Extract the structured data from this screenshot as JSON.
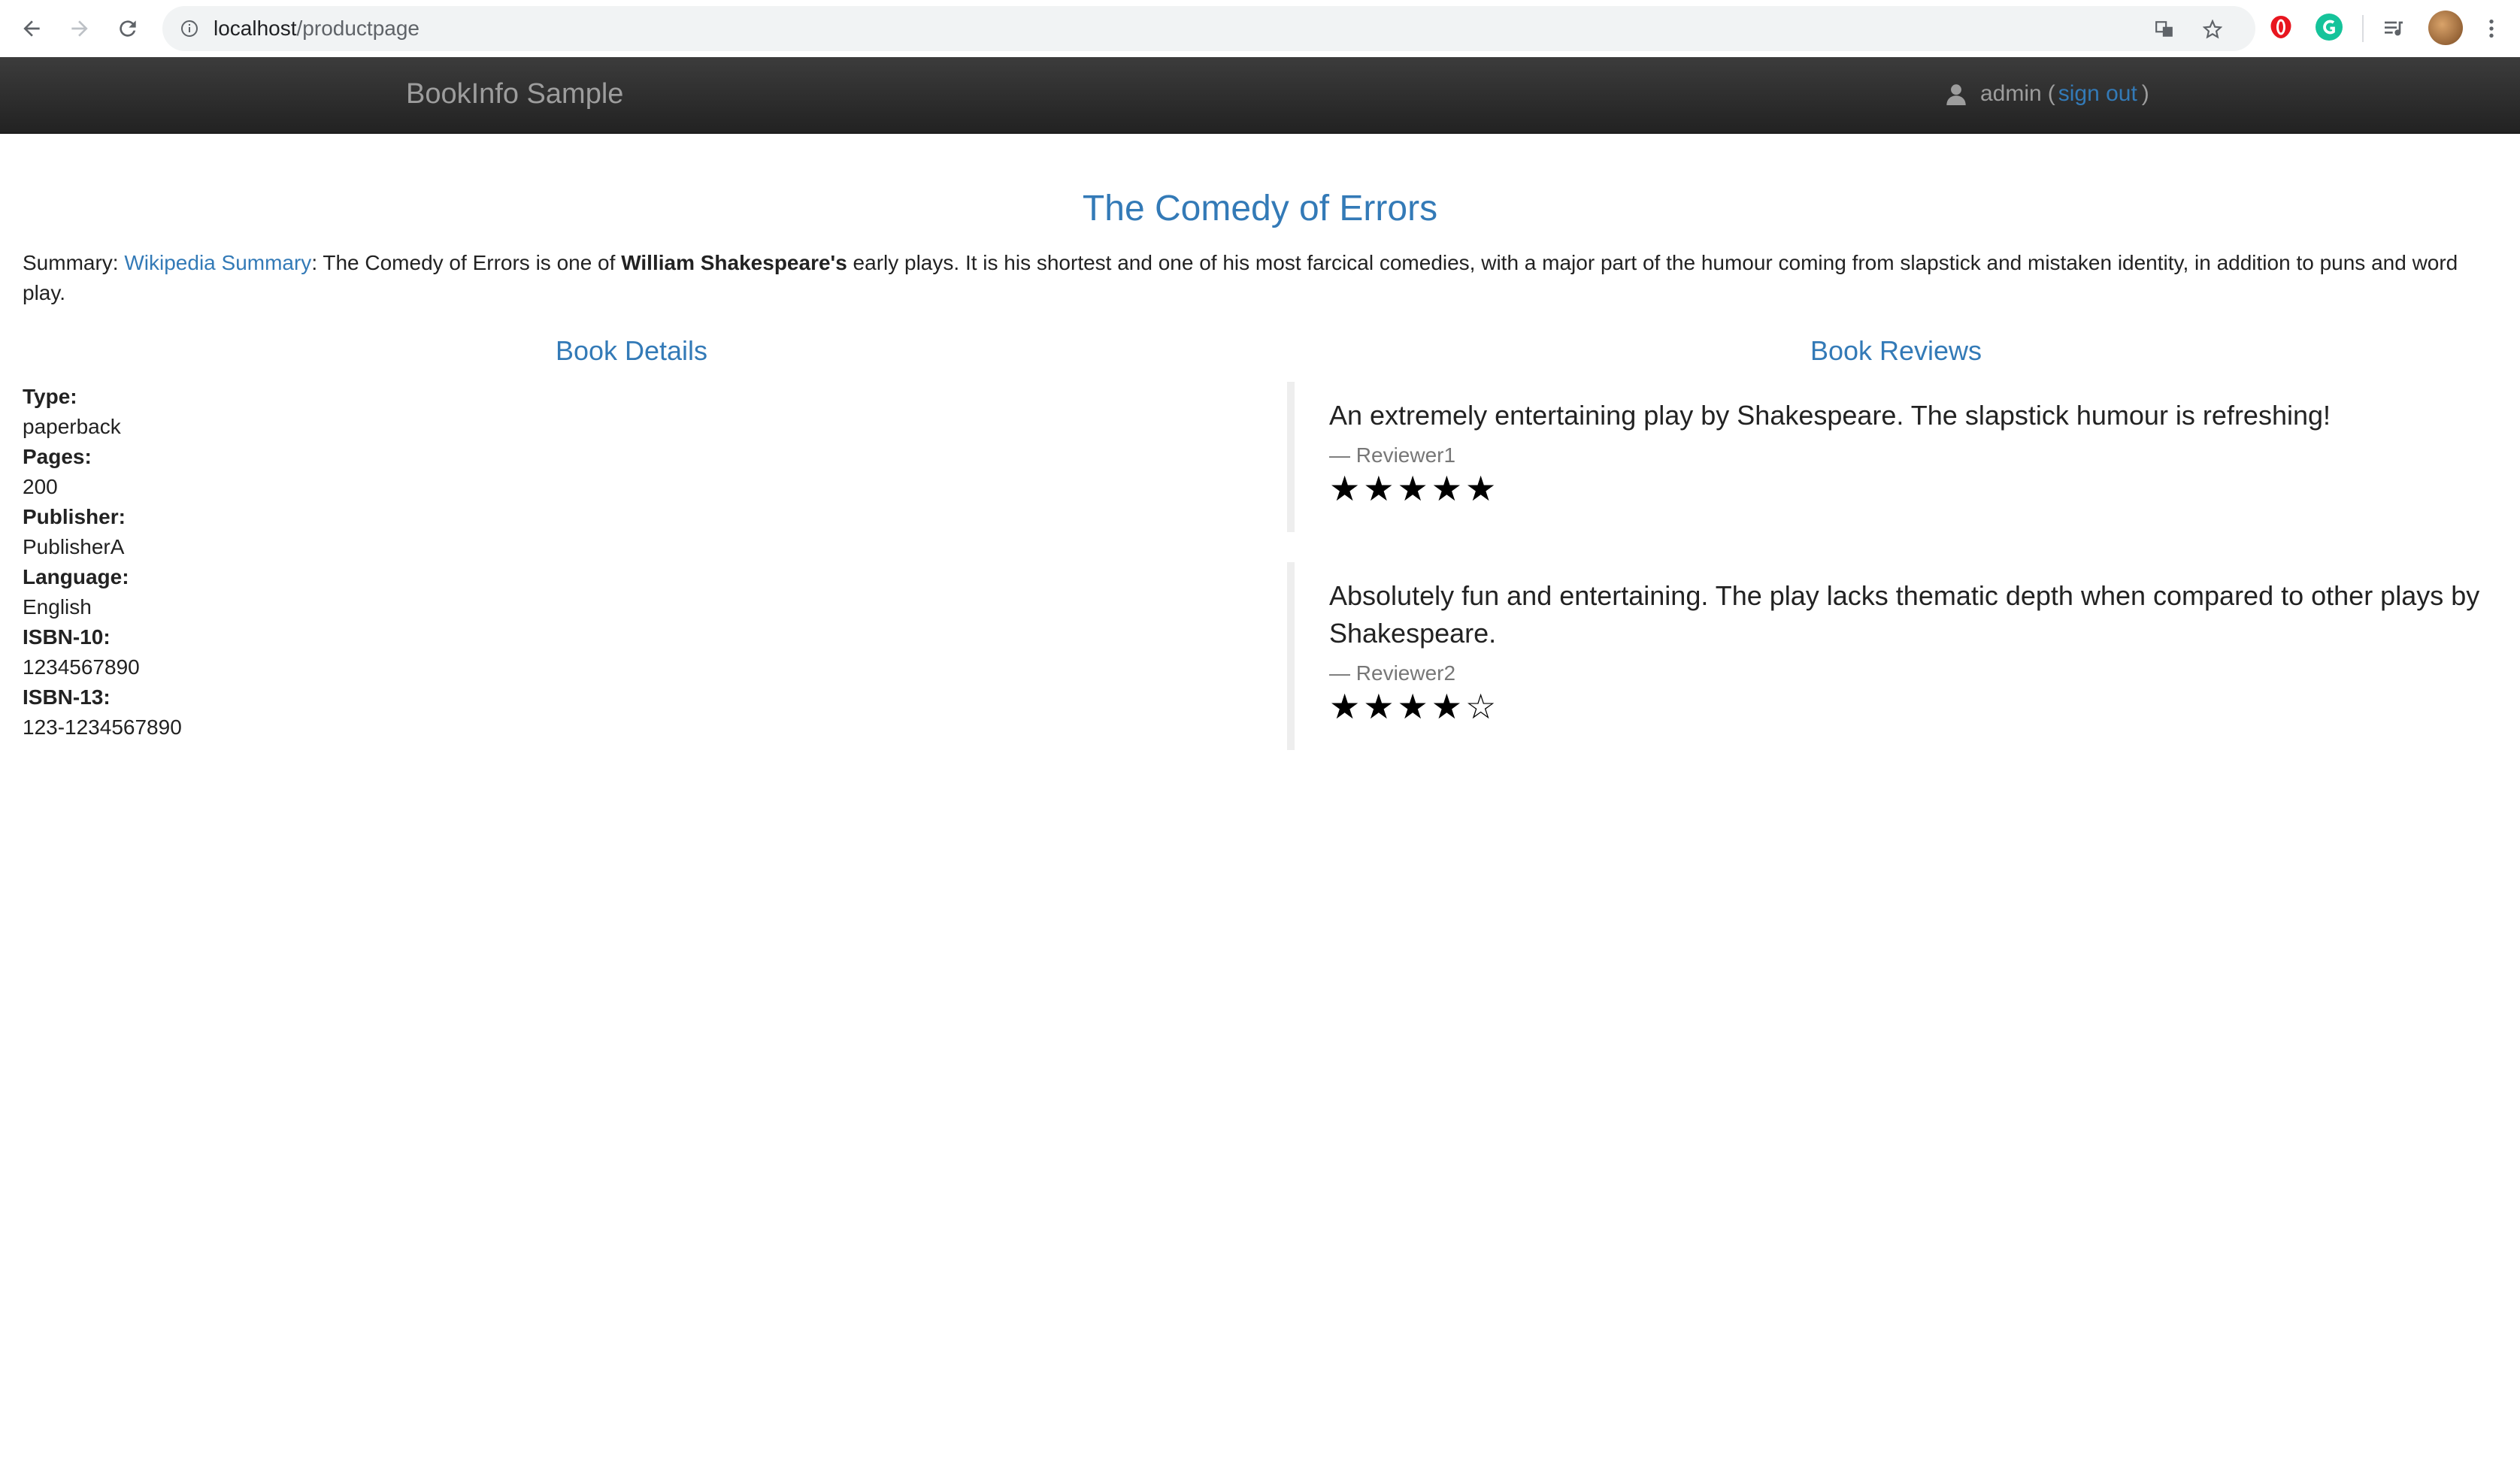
{
  "browser": {
    "url_host": "localhost",
    "url_path": "/productpage"
  },
  "navbar": {
    "brand": "BookInfo Sample",
    "user": "admin",
    "open_paren": "(",
    "sign_out": "sign out",
    "close_paren": ")"
  },
  "page": {
    "title": "The Comedy of Errors",
    "summary": {
      "prefix": "Summary: ",
      "link": "Wikipedia Summary",
      "text_1": ": The Comedy of Errors is one of ",
      "bold": "William Shakespeare's",
      "text_2": " early plays. It is his shortest and one of his most farcical comedies, with a major part of the humour coming from slapstick and mistaken identity, in addition to puns and word play."
    }
  },
  "details": {
    "heading": "Book Details",
    "items": [
      {
        "label": "Type:",
        "value": "paperback"
      },
      {
        "label": "Pages:",
        "value": "200"
      },
      {
        "label": "Publisher:",
        "value": "PublisherA"
      },
      {
        "label": "Language:",
        "value": "English"
      },
      {
        "label": "ISBN-10:",
        "value": "1234567890"
      },
      {
        "label": "ISBN-13:",
        "value": "123-1234567890"
      }
    ]
  },
  "reviews": {
    "heading": "Book Reviews",
    "items": [
      {
        "text": "An extremely entertaining play by Shakespeare. The slapstick humour is refreshing!",
        "author": "— Reviewer1",
        "stars": "★★★★★",
        "rating": 5
      },
      {
        "text": "Absolutely fun and entertaining. The play lacks thematic depth when compared to other plays by Shakespeare.",
        "author": "— Reviewer2",
        "stars": "★★★★☆",
        "rating": 4
      }
    ]
  },
  "colors": {
    "link": "#337ab7",
    "navbar": "#222222"
  }
}
